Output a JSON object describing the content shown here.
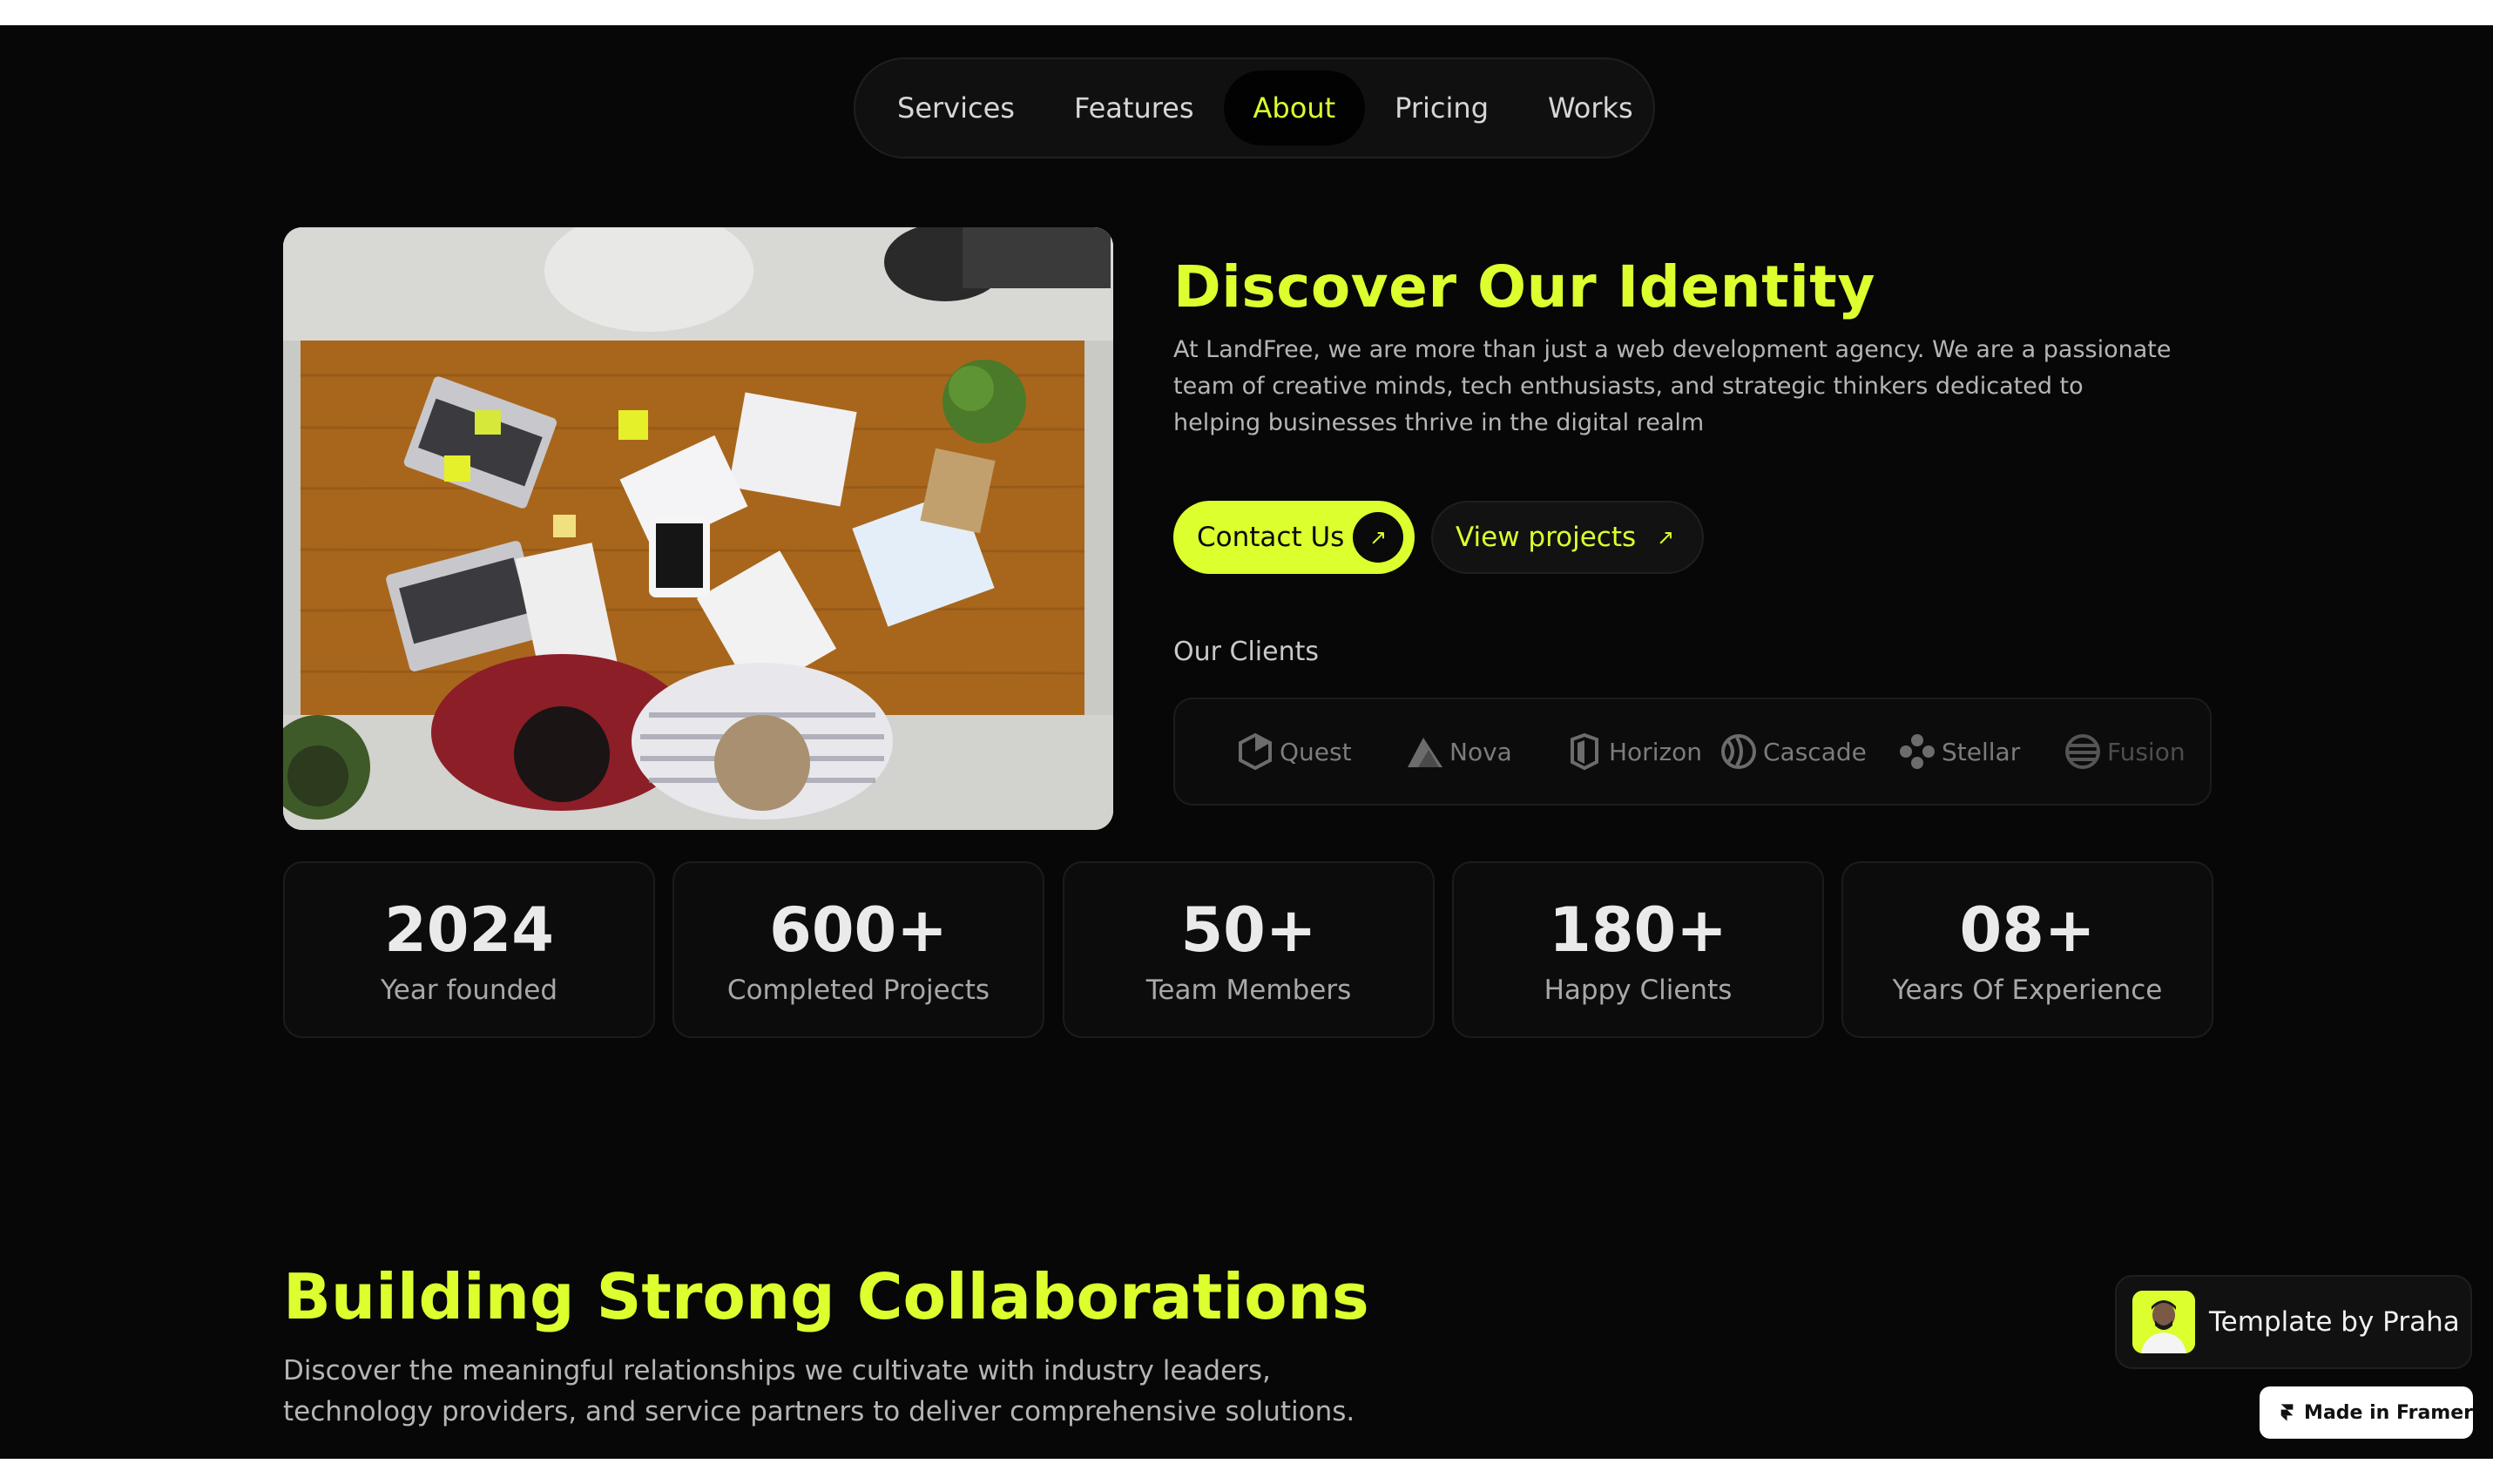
{
  "nav": {
    "items": [
      {
        "label": "Services"
      },
      {
        "label": "Features"
      },
      {
        "label": "About"
      },
      {
        "label": "Pricing"
      },
      {
        "label": "Works"
      }
    ],
    "active": "About"
  },
  "about": {
    "title": "Discover Our Identity",
    "description": "At LandFree, we are more than just a web development agency. We are a passionate team of creative minds, tech enthusiasts, and strategic thinkers dedicated to helping businesses thrive in the digital realm",
    "contact_label": "Contact Us",
    "projects_label": "View projects",
    "clients_label": "Our Clients",
    "clients": [
      {
        "name": "Quest",
        "icon": "hexagon-icon"
      },
      {
        "name": "Nova",
        "icon": "mountain-icon"
      },
      {
        "name": "Horizon",
        "icon": "shield-icon"
      },
      {
        "name": "Cascade",
        "icon": "wave-circle-icon"
      },
      {
        "name": "Stellar",
        "icon": "flower-icon"
      },
      {
        "name": "Fusion",
        "icon": "globe-stripes-icon"
      }
    ]
  },
  "stats": [
    {
      "value": "2024",
      "label": "Year founded"
    },
    {
      "value": "600+",
      "label": "Completed Projects"
    },
    {
      "value": "50+",
      "label": "Team Members"
    },
    {
      "value": "180+",
      "label": "Happy Clients"
    },
    {
      "value": "08+",
      "label": "Years Of Experience"
    }
  ],
  "collab": {
    "title": "Building Strong Collaborations",
    "description": "Discover the meaningful relationships we cultivate with industry leaders, technology providers, and service partners to deliver comprehensive solutions."
  },
  "badges": {
    "template_label": "Template by Praha",
    "framer_label": "Made in Framer"
  },
  "colors": {
    "accent": "#dcff2e",
    "background": "#070707",
    "card": "#0c0c0c"
  }
}
